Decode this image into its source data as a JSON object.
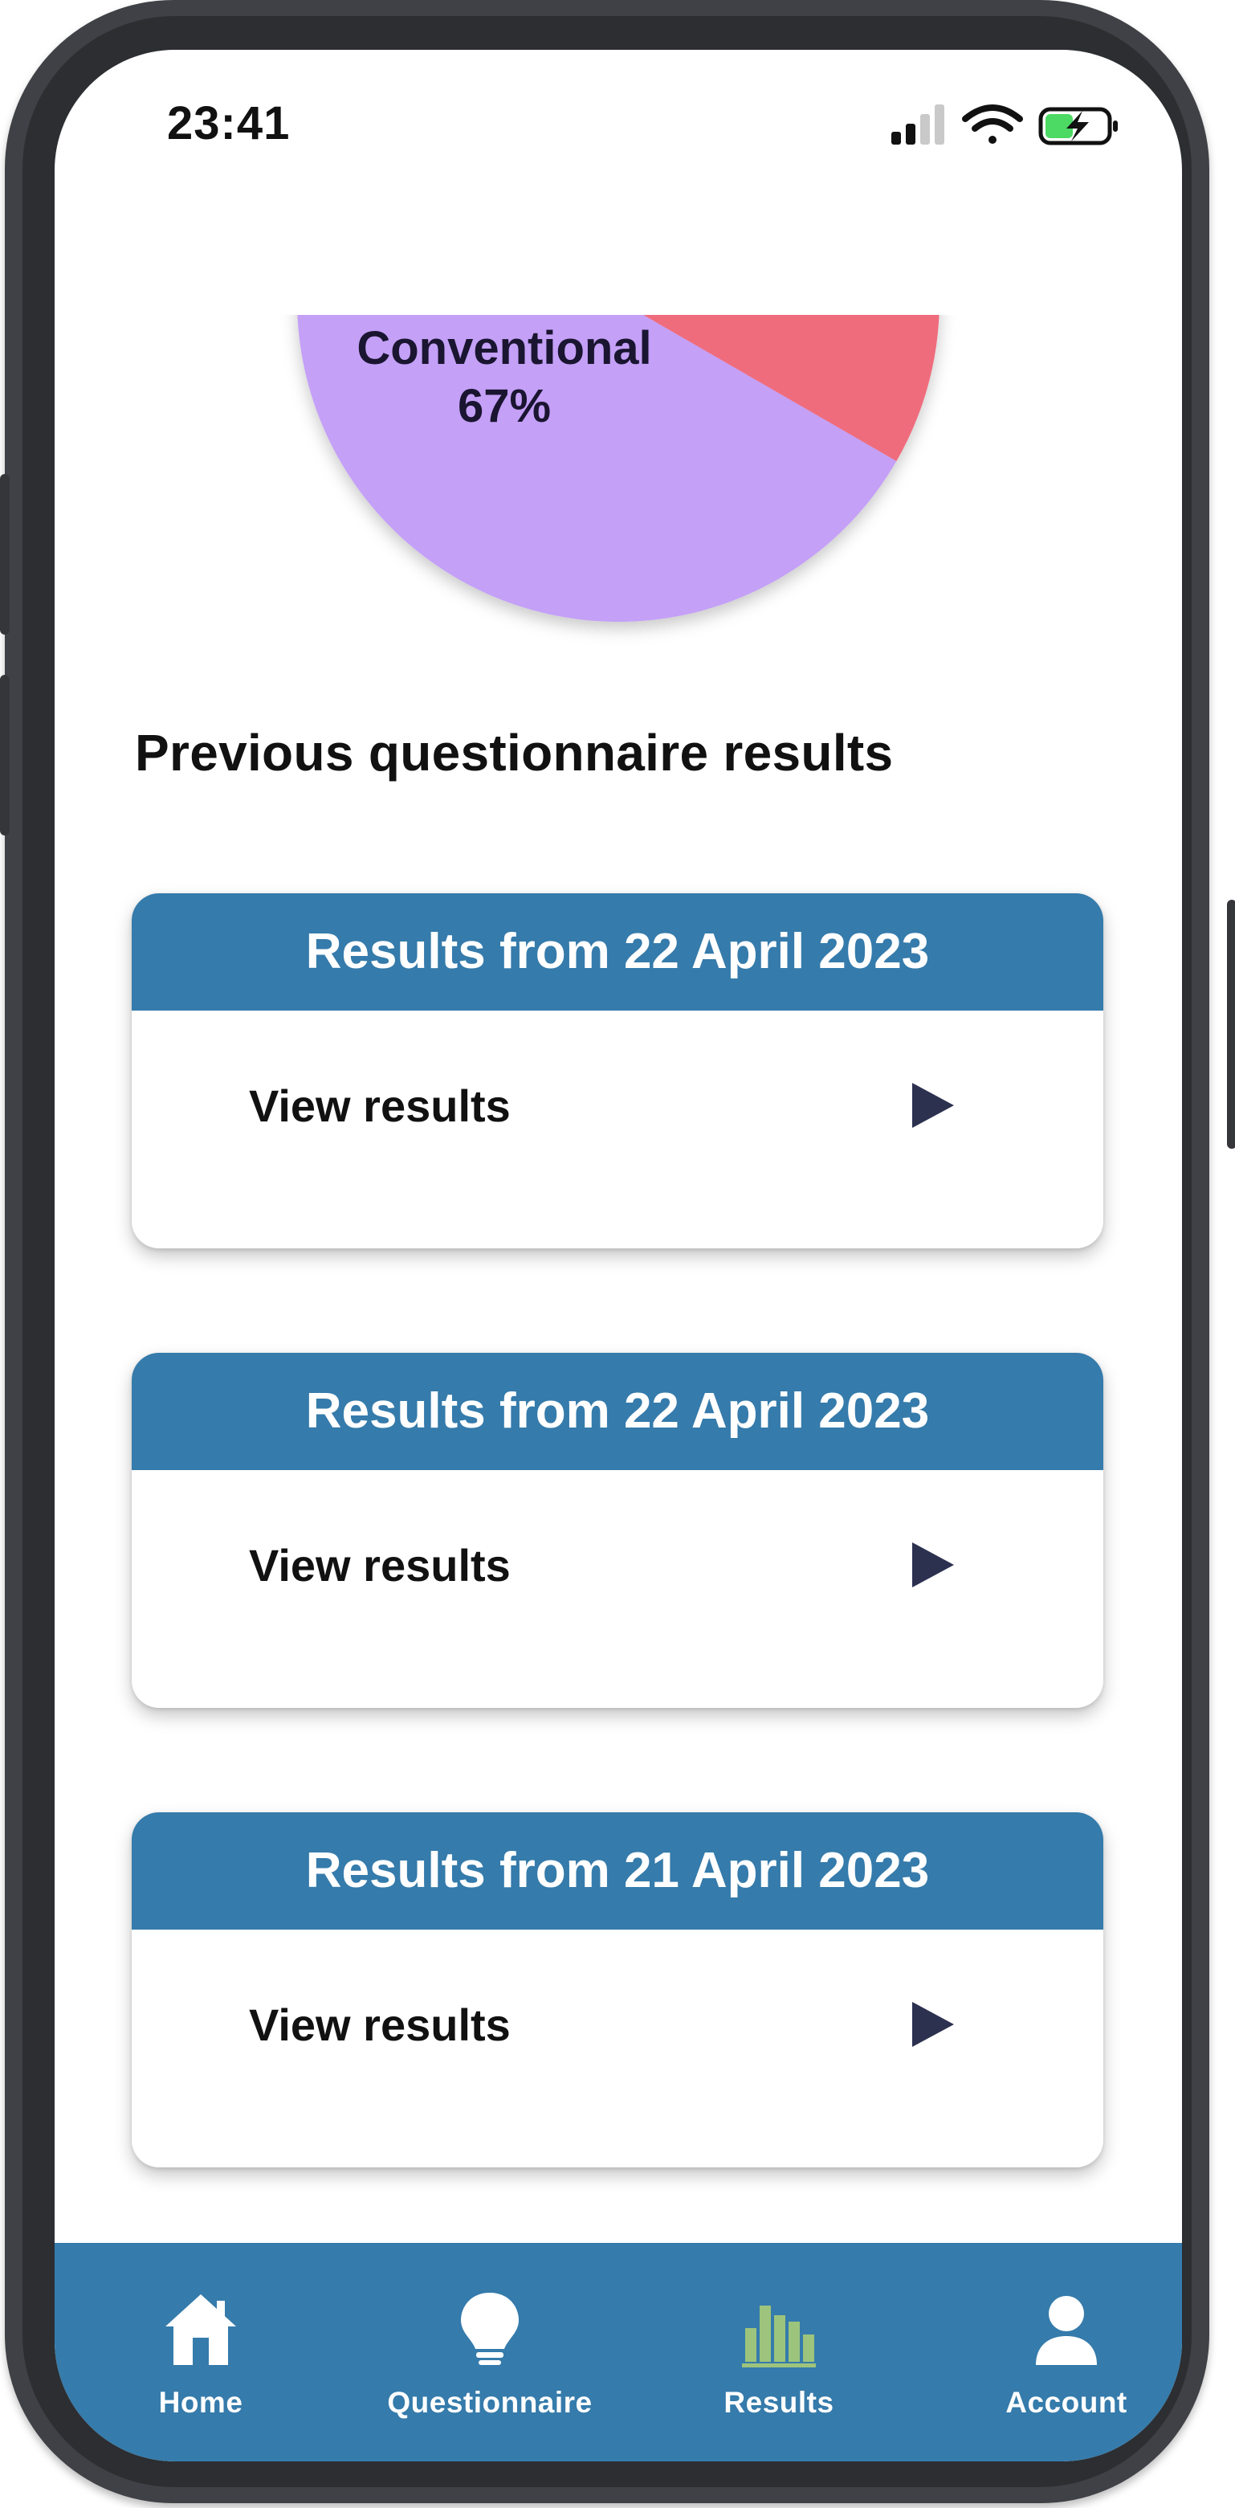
{
  "status": {
    "time": "23:41"
  },
  "chart": {
    "label_name": "Conventional",
    "label_percent": "67%",
    "colors": {
      "conventional": "#c4a0f7",
      "other": "#ef6c7d"
    }
  },
  "section": {
    "title": "Previous questionnaire results"
  },
  "results": [
    {
      "title": "Results from 22 April 2023",
      "link": "View results"
    },
    {
      "title": "Results from 22 April 2023",
      "link": "View results"
    },
    {
      "title": "Results from 21 April 2023",
      "link": "View results"
    }
  ],
  "tabs": [
    {
      "label": "Home",
      "icon": "home-icon"
    },
    {
      "label": "Questionnaire",
      "icon": "lightbulb-icon"
    },
    {
      "label": "Results",
      "icon": "bar-chart-icon",
      "active": true
    },
    {
      "label": "Account",
      "icon": "person-icon"
    }
  ],
  "colors": {
    "accent": "#357bab",
    "active_tab_icon": "#9dc47c",
    "arrow": "#2d3150"
  }
}
